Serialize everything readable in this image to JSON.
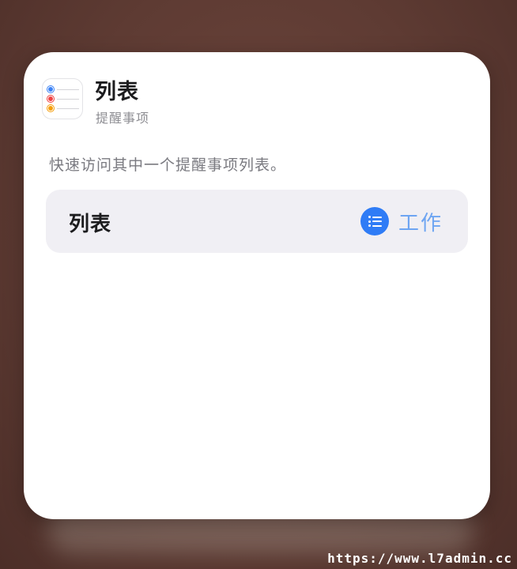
{
  "widget": {
    "title": "列表",
    "subtitle": "提醒事项",
    "app_icon": "reminders-app-icon",
    "description": "快速访问其中一个提醒事项列表。"
  },
  "parameter": {
    "label": "列表",
    "value": "工作",
    "value_icon": "list-bullet-icon",
    "accent_color": "#2f7cf6",
    "value_color": "#6ea5f2"
  },
  "reminder_dots": [
    "#3b82f6",
    "#ef4444",
    "#f59e0b"
  ],
  "watermark": "https://www.l7admin.cc"
}
